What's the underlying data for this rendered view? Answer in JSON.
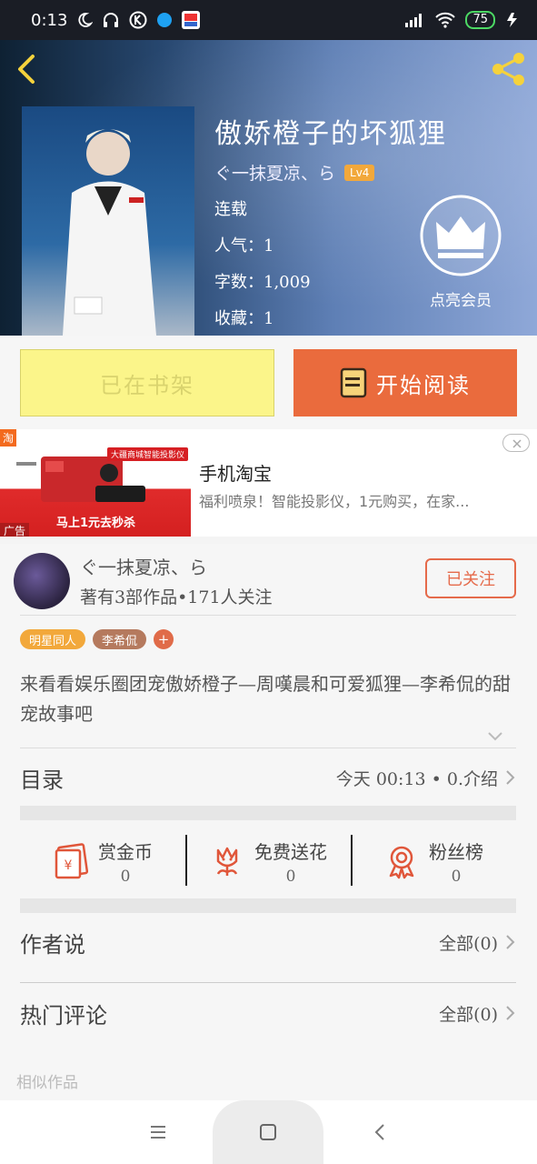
{
  "status_bar": {
    "time": "0:13",
    "battery": "75"
  },
  "book": {
    "title": "傲娇橙子的坏狐狸",
    "author": "ぐ一抹夏凉、ら",
    "level": "Lv4",
    "status": "连载",
    "popularity": "人气：1",
    "word_count": "字数：1,009",
    "collections": "收藏：1",
    "vip_label": "点亮会员"
  },
  "actions": {
    "shelf_label": "已在书架",
    "read_label": "开始阅读"
  },
  "ad": {
    "title": "手机淘宝",
    "description": "福利喷泉！智能投影仪，1元购买，在家...",
    "tag": "广告",
    "badge": "淘",
    "image_caption": "马上1元去秒杀",
    "image_ribbon": "大疆商城智能投影仪"
  },
  "author_block": {
    "name": "ぐ一抹夏凉、ら",
    "info": "著有3部作品•171人关注",
    "follow_label": "已关注",
    "tags": [
      {
        "label": "明星同人",
        "color": "#f2a83b"
      },
      {
        "label": "李希侃",
        "color": "#b57a5e"
      }
    ],
    "tag_add": "+",
    "synopsis": "来看看娱乐圈团宠傲娇橙子—周嘆晨和可爱狐狸—李希侃的甜宠故事吧"
  },
  "toc": {
    "label": "目录",
    "value": "今天 00:13 • 0.介绍"
  },
  "stats": [
    {
      "label": "赏金币",
      "value": "0",
      "icon": "red-envelope-icon"
    },
    {
      "label": "免费送花",
      "value": "0",
      "icon": "flower-icon"
    },
    {
      "label": "粉丝榜",
      "value": "0",
      "icon": "medal-icon"
    }
  ],
  "author_says": {
    "label": "作者说",
    "value": "全部(0)"
  },
  "hot_comments": {
    "label": "热门评论",
    "value": "全部(0)"
  },
  "similar": "相似作品",
  "colors": {
    "accent": "#ea6b3d",
    "shelf": "#fbf58a",
    "follow": "#e56a4a",
    "icon_red": "#e0563a"
  }
}
